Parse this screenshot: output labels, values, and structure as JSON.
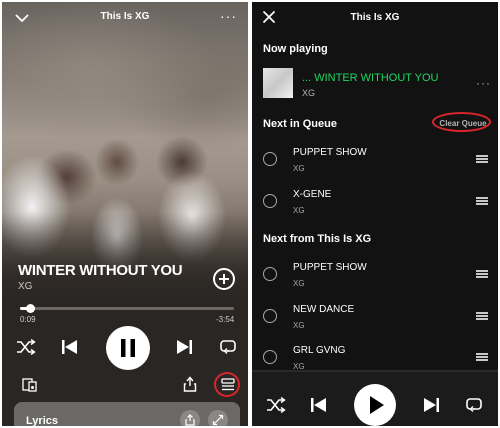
{
  "player": {
    "header_title": "This Is XG",
    "more_glyph": "···",
    "song_title": "WINTER WITHOUT YOU",
    "artist": "XG",
    "progress_fraction": 0.046,
    "time_elapsed": "0:09",
    "time_remaining": "-3:54",
    "lyrics_label": "Lyrics"
  },
  "queue": {
    "header_title": "This Is XG",
    "now_playing_label": "Now playing",
    "now_playing": {
      "title": "... WINTER WITHOUT YOU",
      "artist": "XG",
      "more_glyph": "···"
    },
    "next_in_queue_label": "Next in Queue",
    "clear_queue_label": "Clear Queue",
    "next_in_queue": [
      {
        "title": "PUPPET SHOW",
        "artist": "XG"
      },
      {
        "title": "X-GENE",
        "artist": "XG"
      }
    ],
    "next_from_label": "Next from This Is XG",
    "next_from": [
      {
        "title": "PUPPET SHOW",
        "artist": "XG"
      },
      {
        "title": "NEW DANCE",
        "artist": "XG"
      },
      {
        "title": "GRL GVNG",
        "artist": "XG"
      }
    ]
  },
  "colors": {
    "accent_green": "#1ed760",
    "highlight_red": "#d9262c",
    "queue_bg": "#121212"
  },
  "icons": [
    "chevron-down-icon",
    "more-icon",
    "add-icon",
    "shuffle-icon",
    "previous-icon",
    "pause-icon",
    "play-icon",
    "next-icon",
    "repeat-icon",
    "devices-icon",
    "share-icon",
    "queue-icon",
    "close-icon",
    "drag-handle-icon",
    "radio-icon",
    "expand-icon"
  ]
}
